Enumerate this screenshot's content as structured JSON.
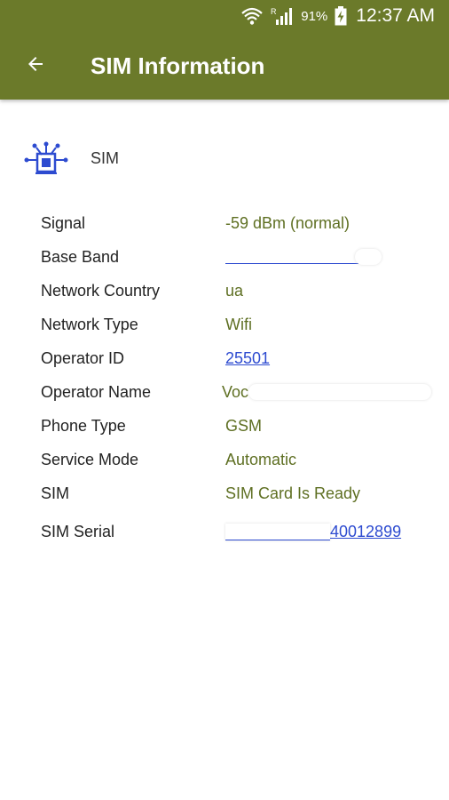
{
  "status_bar": {
    "wifi_icon": "wifi-icon",
    "signal_icon": "signal-icon",
    "signal_badge": "R",
    "battery_pct": "91%",
    "battery_icon": "battery-charging-icon",
    "time": "12:37 AM"
  },
  "toolbar": {
    "back_icon": "arrow-back-icon",
    "title": "SIM Information",
    "color": "#6b7a2a"
  },
  "section": {
    "icon": "sim-network-icon",
    "title": "SIM"
  },
  "rows": [
    {
      "label": "Signal",
      "value": "-59 dBm (normal)"
    },
    {
      "label": "Base Band",
      "value": ""
    },
    {
      "label": "Network Country",
      "value": "ua"
    },
    {
      "label": "Network Type",
      "value": "Wifi"
    },
    {
      "label": "Operator ID",
      "value": "25501"
    },
    {
      "label": "Operator Name",
      "value": "Voc"
    },
    {
      "label": "Phone Type",
      "value": "GSM"
    },
    {
      "label": "Service Mode",
      "value": "Automatic"
    },
    {
      "label": "SIM",
      "value": "SIM Card Is Ready"
    },
    {
      "label": "SIM Serial",
      "value": "40012899"
    }
  ],
  "colors": {
    "value_text": "#5e6f22",
    "link_text": "#2d4bd0",
    "icon": "#2d4bd0"
  }
}
